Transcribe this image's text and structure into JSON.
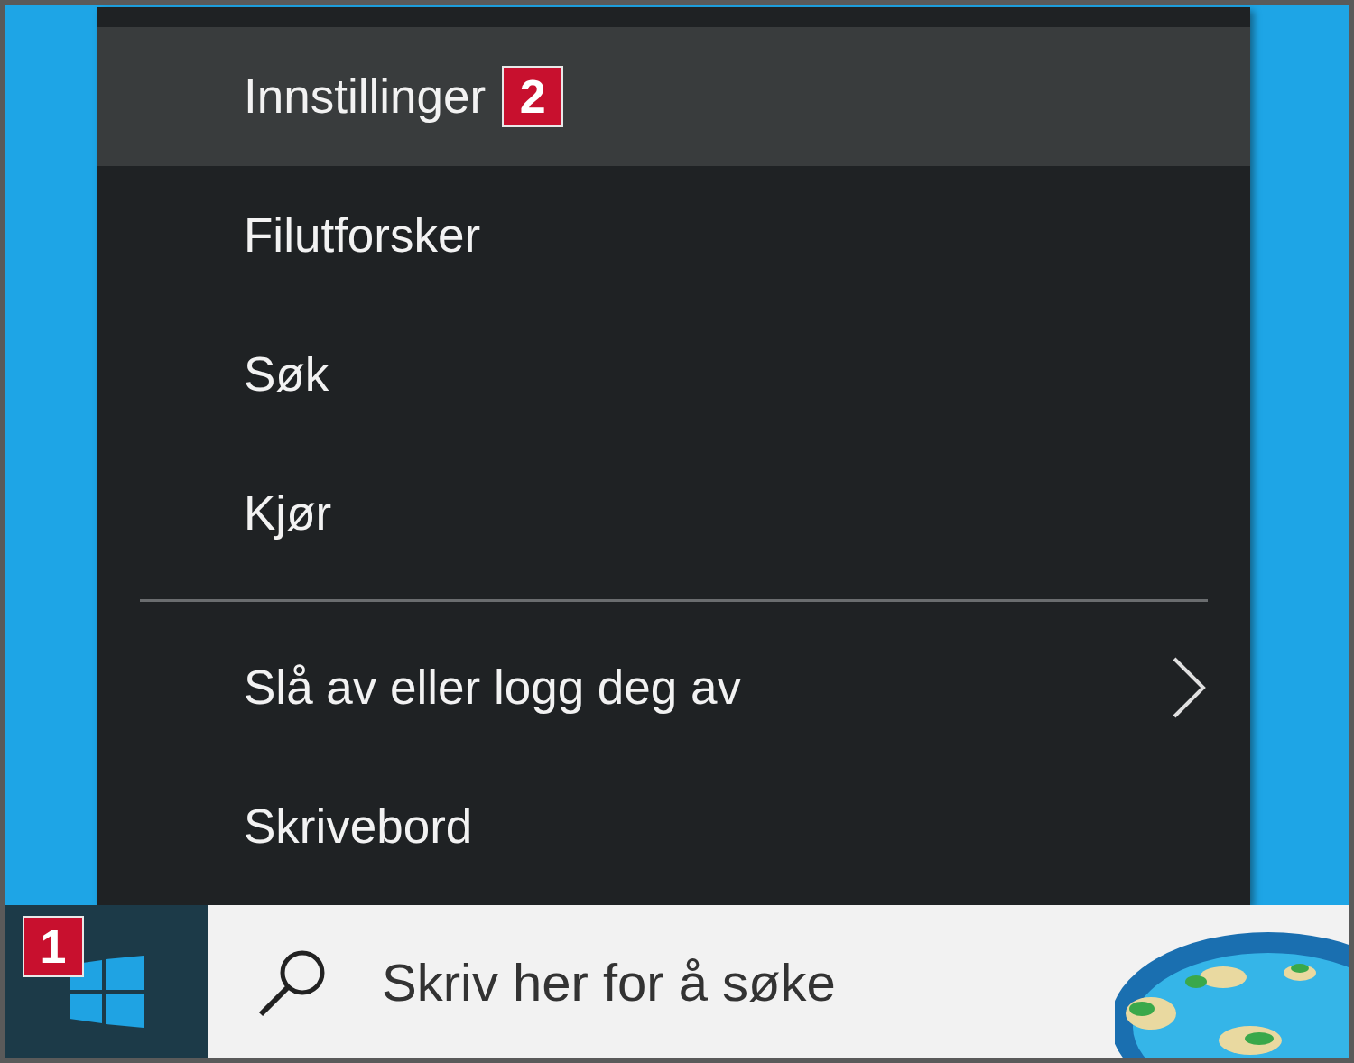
{
  "menu": {
    "items": [
      {
        "kind": "item",
        "label": "Innstillinger",
        "selected": true,
        "badge": "2"
      },
      {
        "kind": "item",
        "label": "Filutforsker",
        "selected": false
      },
      {
        "kind": "item",
        "label": "Søk",
        "selected": false
      },
      {
        "kind": "item",
        "label": "Kjør",
        "selected": false
      },
      {
        "kind": "separator"
      },
      {
        "kind": "submenu",
        "label": "Slå av eller logg deg av",
        "selected": false
      },
      {
        "kind": "item",
        "label": "Skrivebord",
        "selected": false
      }
    ]
  },
  "taskbar": {
    "start_button": {
      "badge": "1"
    },
    "search": {
      "placeholder": "Skriv her for å søke"
    }
  }
}
